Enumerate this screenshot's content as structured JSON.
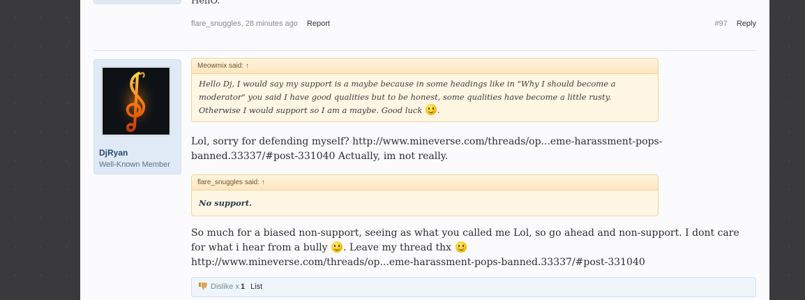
{
  "previous_post": {
    "text": "HellO.",
    "author": "flare_snuggles",
    "time": "28 minutes ago",
    "report_label": "Report",
    "post_number": "#97",
    "reply_label": "Reply"
  },
  "post": {
    "username": "DjRyan",
    "user_title": "Well-Known Member",
    "quote1": {
      "header": "Meowmix said: ↑",
      "body": "Hello Dj, I would say my support is a maybe because in some headings like in \"Why I should become a moderator\" you said I have good qualities but to be honest, some qualities have become a little rusty. Otherwise I would support so I am a maybe. Good luck",
      "tail": "."
    },
    "message1": "Lol, sorry for defending myself? http://www.mineverse.com/threads/op...eme-harassment-pops-banned.33337/#post-331040 Actually, im not really.",
    "quote2": {
      "header": "flare_snuggles said: ↑",
      "body": "No support."
    },
    "message2_part1": "So much for a biased non-support, seeing as what you called me Lol, so go ahead and non-support. I dont care for what i hear from a bully",
    "message2_part2": ". Leave my thread thx",
    "message2_link": "http://www.mineverse.com/threads/op...eme-harassment-pops-banned.33337/#post-331040",
    "dislike": {
      "label": "Dislike x",
      "count": "1",
      "list_label": "List"
    }
  },
  "colors": {
    "page_bg": "#fbfbfd",
    "userbox_bg": "#dfeaf6",
    "quote_bg": "#fff6e4",
    "username": "#2a4a6e"
  },
  "icons": [
    "treble-clef-avatar",
    "smiley-icon",
    "thumbs-down-icon"
  ]
}
